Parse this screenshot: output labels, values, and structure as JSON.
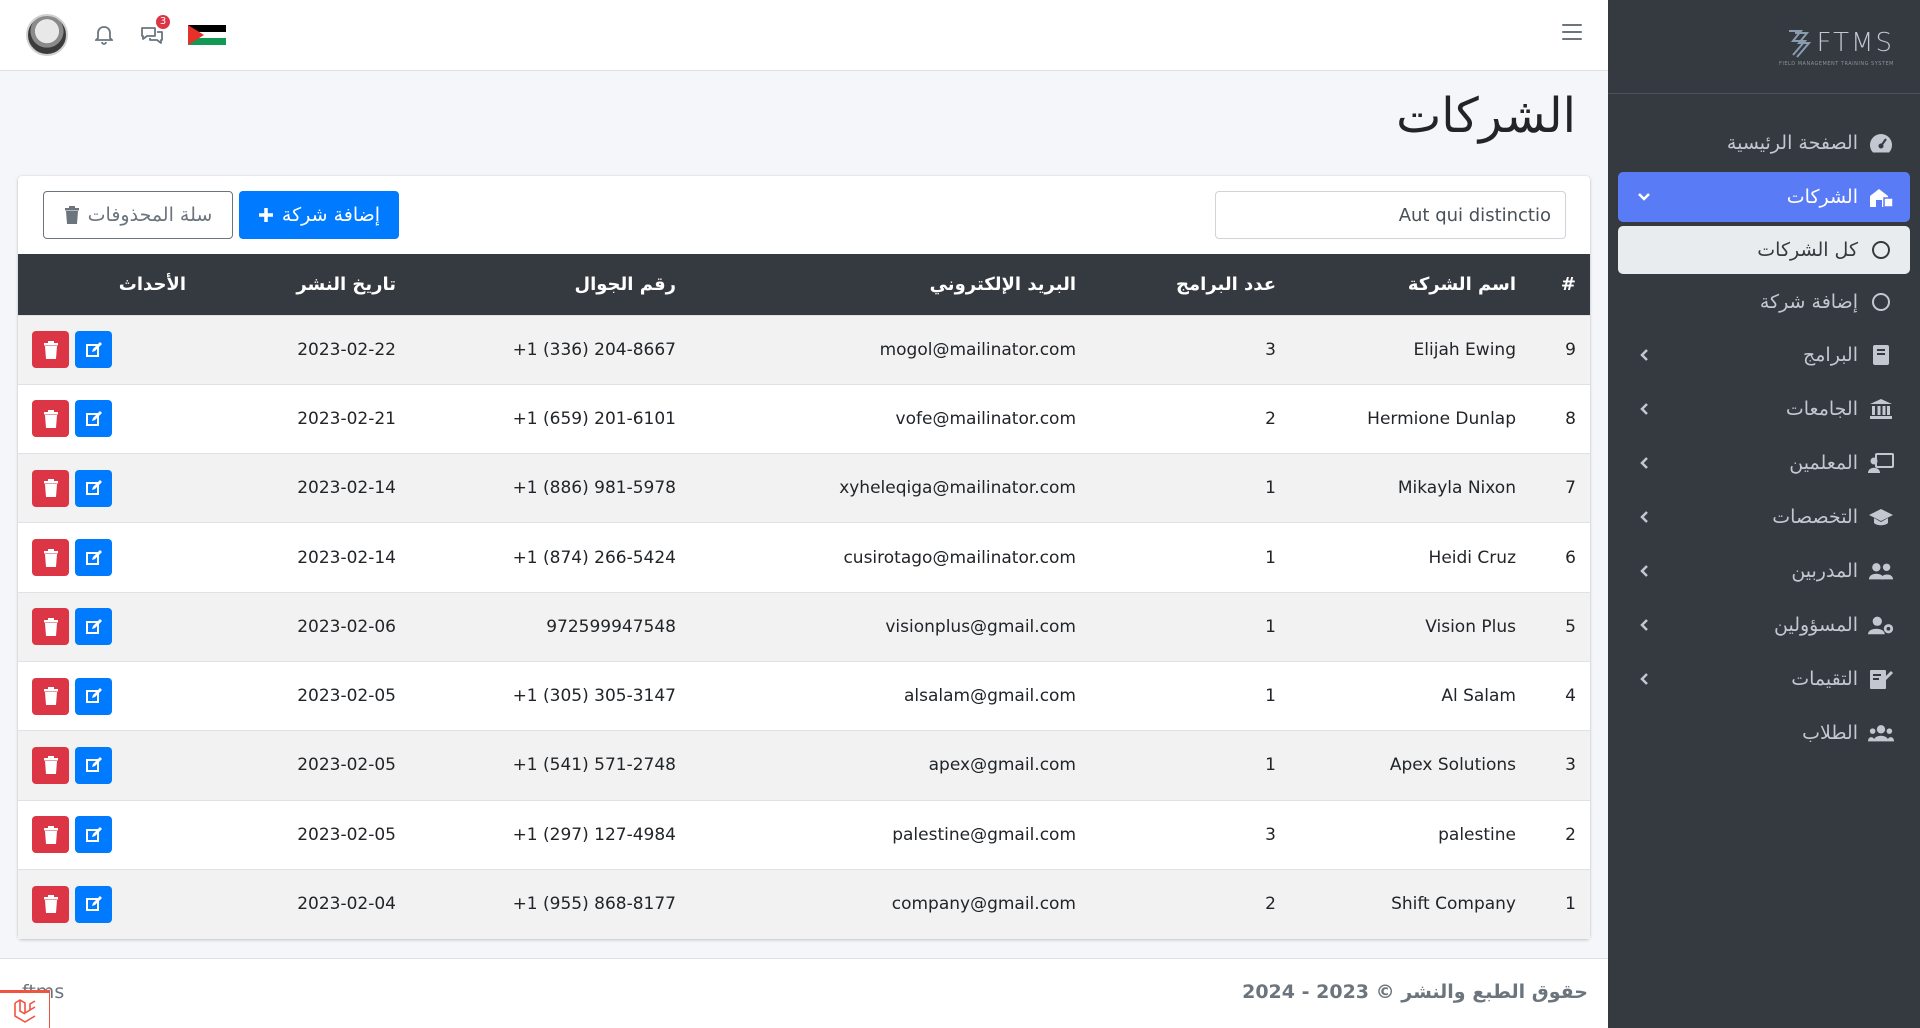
{
  "app": {
    "brand": "FTMS",
    "brand_tagline": "FIELD MANAGEMENT TRAINING SYSTEM"
  },
  "topbar": {
    "messages_badge": "3"
  },
  "sidebar": {
    "items": [
      {
        "label": "الصفحة الرئيسية",
        "icon": "dashboard-icon"
      },
      {
        "label": "الشركات",
        "icon": "company-icon",
        "active": true
      },
      {
        "label": "كل الشركات",
        "icon": "circle-icon"
      },
      {
        "label": "إضافة شركة",
        "icon": "circle-icon"
      },
      {
        "label": "البرامج",
        "icon": "book-icon"
      },
      {
        "label": "الجامعات",
        "icon": "university-icon"
      },
      {
        "label": "المعلمين",
        "icon": "teacher-icon"
      },
      {
        "label": "التخصصات",
        "icon": "graduation-cap-icon"
      },
      {
        "label": "المدربين",
        "icon": "users-icon"
      },
      {
        "label": "المسؤولين",
        "icon": "user-cog-icon"
      },
      {
        "label": "التقيمات",
        "icon": "evaluation-icon"
      },
      {
        "label": "الطلاب",
        "icon": "students-icon"
      }
    ]
  },
  "main": {
    "title": "الشركات",
    "search_value": "Aut qui distinctio",
    "add_button": "إضافة شركة",
    "trash_button": "سلة المحذوفات"
  },
  "table": {
    "headers": [
      "#",
      "اسم الشركة",
      "عدد البرامج",
      "البريد الإلكتروني",
      "رقم الجوال",
      "تاريخ النشر",
      "الأحداث"
    ],
    "rows": [
      [
        "9",
        "Elijah Ewing",
        "3",
        "mogol@mailinator.com",
        "+1 (336) 204-8667",
        "2023-02-22"
      ],
      [
        "8",
        "Hermione Dunlap",
        "2",
        "vofe@mailinator.com",
        "+1 (659) 201-6101",
        "2023-02-21"
      ],
      [
        "7",
        "Mikayla Nixon",
        "1",
        "xyheleqiga@mailinator.com",
        "+1 (886) 981-5978",
        "2023-02-14"
      ],
      [
        "6",
        "Heidi Cruz",
        "1",
        "cusirotago@mailinator.com",
        "+1 (874) 266-5424",
        "2023-02-14"
      ],
      [
        "5",
        "Vision Plus",
        "1",
        "visionplus@gmail.com",
        "972599947548",
        "2023-02-06"
      ],
      [
        "4",
        "Al Salam",
        "1",
        "alsalam@gmail.com",
        "+1 (305) 305-3147",
        "2023-02-05"
      ],
      [
        "3",
        "Apex Solutions",
        "1",
        "apex@gmail.com",
        "+1 (541) 571-2748",
        "2023-02-05"
      ],
      [
        "2",
        "palestine",
        "3",
        "palestine@gmail.com",
        "+1 (297) 127-4984",
        "2023-02-05"
      ],
      [
        "1",
        "Shift Company",
        "2",
        "company@gmail.com",
        "+1 (955) 868-8177",
        "2023-02-04"
      ]
    ]
  },
  "footer": {
    "copyright": "حقوق الطبع والنشر © 2023 - 2024",
    "left_text": "ftms"
  }
}
